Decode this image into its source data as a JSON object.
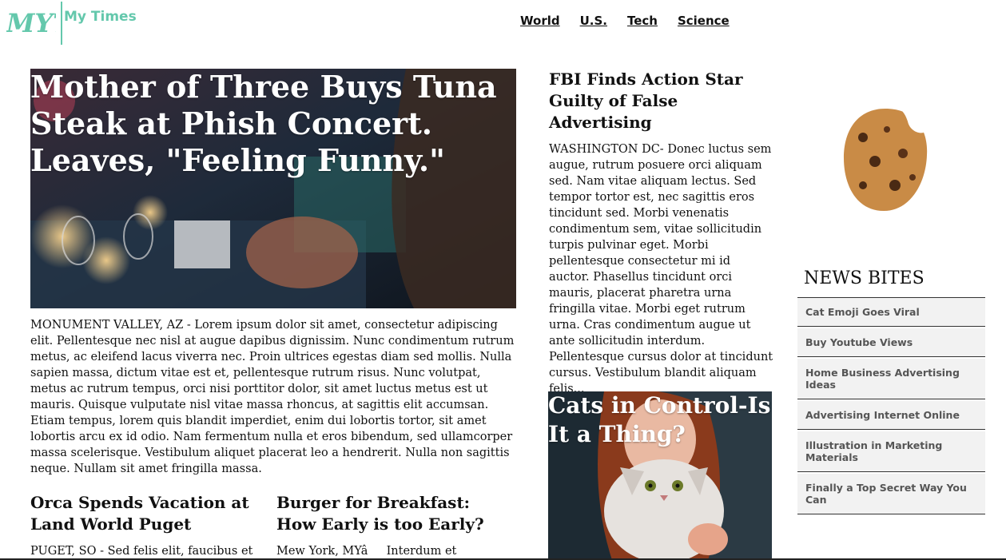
{
  "header": {
    "logo_text": "MYT",
    "site_name": "My Times",
    "nav": [
      "World",
      "U.S.",
      "Tech",
      "Science"
    ]
  },
  "hero": {
    "title": "Mother of Three Buys Tuna Steak at Phish Concert. Leaves, \"Feeling Funny.\"",
    "body": "MONUMENT VALLEY, AZ - Lorem ipsum dolor sit amet, consectetur adipiscing elit. Pellentesque nec nisl at augue dapibus dignissim. Nunc condimentum rutrum metus, ac eleifend lacus viverra nec. Proin ultrices egestas diam sed mollis. Nulla sapien massa, dictum vitae est et, pellentesque rutrum risus. Nunc volutpat, metus ac rutrum tempus, orci nisi porttitor dolor, sit amet luctus metus est ut mauris. Quisque vulputate nisl vitae massa rhoncus, at sagittis elit accumsan. Etiam tempus, lorem quis blandit imperdiet, enim dui lobortis tortor, sit amet lobortis arcu ex id odio. Nam fermentum nulla et eros bibendum, sed ullamcorper massa scelerisque. Vestibulum aliquet placerat leo a hendrerit. Nulla non sagittis neque. Nullam sit amet fringilla massa."
  },
  "stories": [
    {
      "title": "Orca Spends Vacation at Land World Puget",
      "body": "PUGET, SO - Sed felis elit, faucibus et"
    },
    {
      "title": "Burger for Breakfast: How Early is too Early?",
      "body": "Mew York, MYâInterdum et"
    }
  ],
  "fbi": {
    "title": "FBI Finds Action Star Guilty of False Advertising",
    "body": "WASHINGTON DC- Donec luctus sem augue, rutrum posuere orci aliquam sed. Nam vitae aliquam lectus. Sed tempor tortor est, nec sagittis eros tincidunt sed. Morbi venenatis condimentum sem, vitae sollicitudin turpis pulvinar eget. Morbi pellentesque consectetur mi id auctor. Phasellus tincidunt orci mauris, placerat pharetra urna fringilla vitae. Morbi eget rutrum urna. Cras condimentum augue ut ante sollicitudin interdum. Pellentesque cursus dolor at tincidunt cursus. Vestibulum blandit aliquam felis..."
  },
  "cats": {
    "title": "Cats in Control-Is It a Thing?"
  },
  "news_bites": {
    "title": "NEWS BITES",
    "items": [
      "Cat Emoji Goes Viral",
      "Buy Youtube Views",
      "Home Business Advertising Ideas",
      "Advertising Internet Online",
      "Illustration in Marketing Materials",
      "Finally a Top Secret Way You Can"
    ]
  },
  "colors": {
    "accent": "#64c8ac",
    "list_bg": "#f2f2f2"
  }
}
